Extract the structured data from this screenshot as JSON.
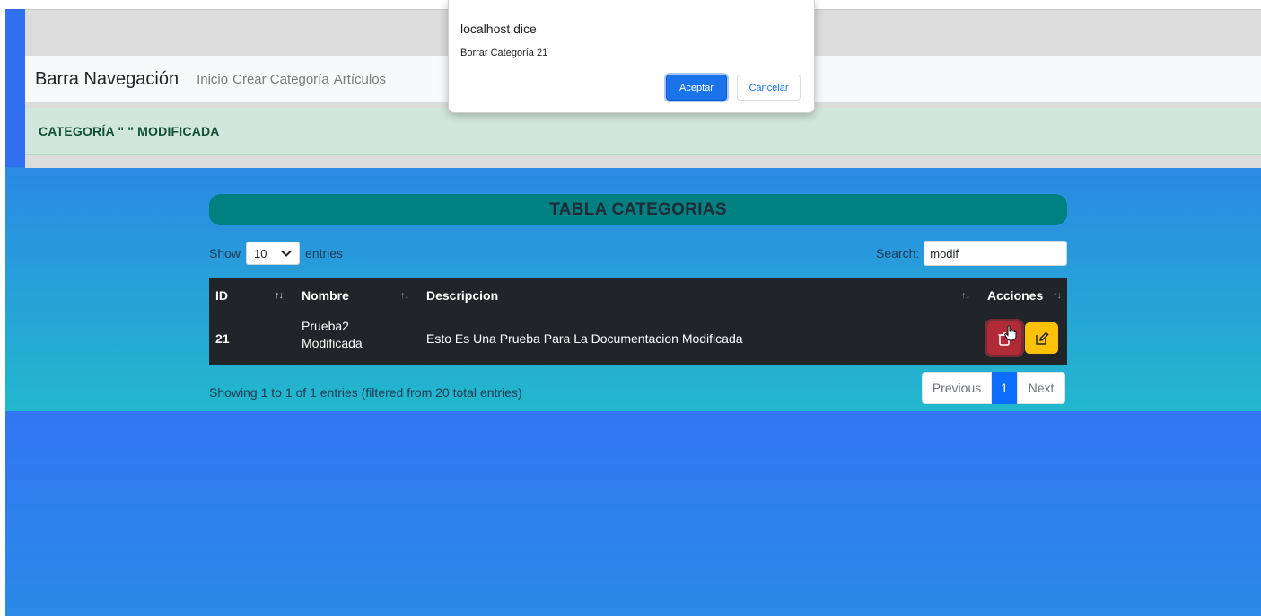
{
  "dialog": {
    "title": "localhost dice",
    "message": "Borrar Categoría 21",
    "accept_label": "Aceptar",
    "cancel_label": "Cancelar"
  },
  "navbar": {
    "brand": "Barra Navegación",
    "links": [
      "Inicio",
      "Crear Categoría",
      "Artículos"
    ]
  },
  "alert": {
    "text": "CATEGORÍA \" \" MODIFICADA"
  },
  "table_title": "TABLA CATEGORIAS",
  "length_control": {
    "show": "Show",
    "value": "10",
    "entries": "entries"
  },
  "search": {
    "label": "Search:",
    "value": "modif"
  },
  "table": {
    "headers": [
      "ID",
      "Nombre",
      "Descripcion",
      "Acciones"
    ],
    "rows": [
      {
        "id": "21",
        "nombre_line1": "Prueba2",
        "nombre_line2": "Modificada",
        "descripcion": "Esto Es Una Prueba Para La Documentacion Modificada"
      }
    ]
  },
  "info": "Showing 1 to 1 of 1 entries (filtered from 20 total entries)",
  "pagination": {
    "previous": "Previous",
    "current": "1",
    "next": "Next"
  },
  "icons": {
    "delete": "trash-icon",
    "edit": "edit-icon",
    "cursor": "hand-pointer-icon",
    "sort": "sort-icon",
    "dropdown": "chevron-down-icon"
  },
  "colors": {
    "delete_button": "#b02a37",
    "edit_button": "#ffc107",
    "table_header": "#008080",
    "alert_bg": "#d1e7dd"
  }
}
